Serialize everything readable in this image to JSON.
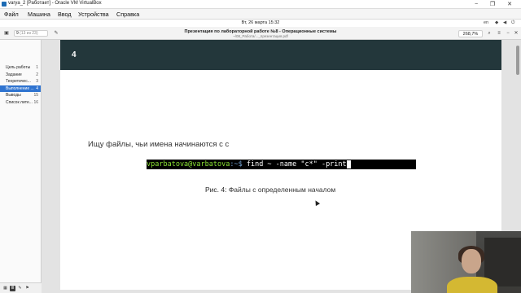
{
  "window": {
    "title": "varya_2 [Работает] - Oracle VM VirtualBox",
    "controls": {
      "minimize": "−",
      "maximize": "❐",
      "close": "✕"
    }
  },
  "menubar": {
    "items": [
      "Файл",
      "Машина",
      "Ввод",
      "Устройства",
      "Справка"
    ]
  },
  "guest_topbar": {
    "clock": "Вт, 26 марта  15:32",
    "lang": "en"
  },
  "viewer": {
    "page_current": "9",
    "page_of": "(13 из 23)",
    "doc_title": "Презентация по лабораторной работе №8 - Операционные системы",
    "doc_subtitle": "~/08_Работа/..._презентация.pdf",
    "zoom": "268,7%"
  },
  "sidebar": {
    "items": [
      {
        "label": "Цель работы",
        "page": "1",
        "active": false
      },
      {
        "label": "Задание",
        "page": "2",
        "active": false
      },
      {
        "label": "Теоретичес...",
        "page": "3",
        "active": false
      },
      {
        "label": "Выполнение ...",
        "page": "4",
        "active": true
      },
      {
        "label": "Выводы",
        "page": "15",
        "active": false
      },
      {
        "label": "Список лите...",
        "page": "16",
        "active": false
      }
    ]
  },
  "slide": {
    "number": "4",
    "text": "Ищу файлы, чьи имена начинаются с с",
    "terminal": {
      "user_host": "vparbatova@varbatova",
      "path": ":~$",
      "command": " find ~ -name \"c*\" -print"
    },
    "caption_label": "Рис. 4:",
    "caption_text": " Файлы с определенным началом"
  },
  "colors": {
    "slide_header": "#23373b",
    "sidebar_active": "#2f74d0",
    "terminal_user": "#8ae234"
  }
}
